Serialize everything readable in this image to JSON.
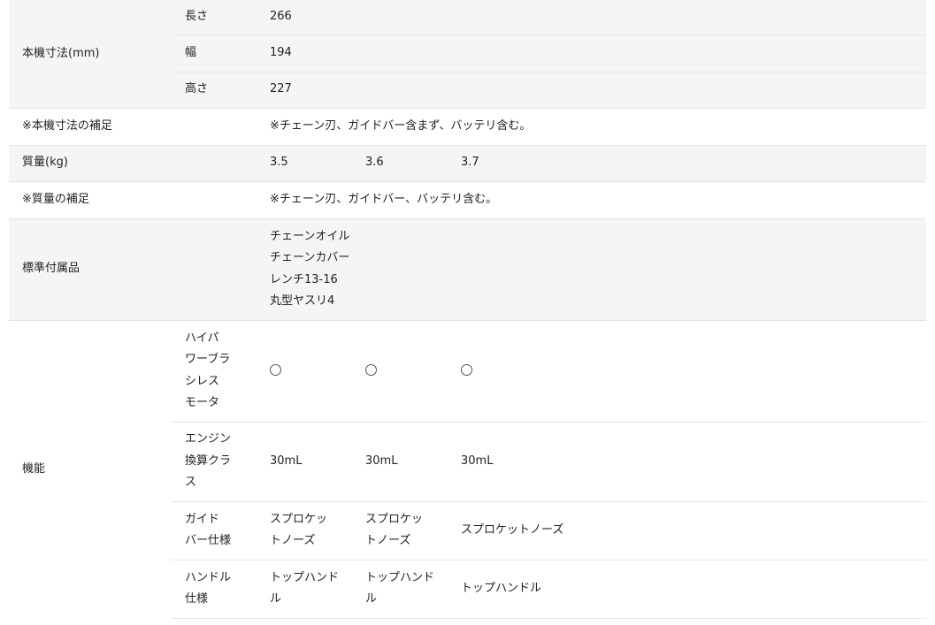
{
  "dimensions": {
    "label": "本機寸法(mm)",
    "length_label": "長さ",
    "length_value": "266",
    "width_label": "幅",
    "width_value": "194",
    "height_label": "高さ",
    "height_value": "227"
  },
  "dimensions_note": {
    "label": "※本機寸法の補足",
    "value": "※チェーン刃、ガイドバー含まず、バッテリ含む。"
  },
  "weight": {
    "label": "質量(kg)",
    "values": [
      "3.5",
      "3.6",
      "3.7"
    ]
  },
  "weight_note": {
    "label": "※質量の補足",
    "value": "※チェーン刃、ガイドバー、バッテリ含む。"
  },
  "accessories": {
    "label": "標準付属品",
    "items": [
      "チェーンオイル",
      "チェーンカバー",
      "レンチ13-16",
      "丸型ヤスリ4"
    ]
  },
  "functions": {
    "label": "機能",
    "motor": {
      "label_lines": [
        "ハイパ",
        "ワーブラ",
        "シレス",
        "モータ"
      ],
      "values": [
        "○",
        "○",
        "○"
      ]
    },
    "engine_equiv": {
      "label_lines": [
        "エンジン",
        "換算クラ",
        "ス"
      ],
      "values": [
        "30mL",
        "30mL",
        "30mL"
      ]
    },
    "guide_bar": {
      "label_lines": [
        "ガイド",
        "バー仕様"
      ],
      "col1_lines": [
        "スプロケッ",
        "トノーズ"
      ],
      "col2_lines": [
        "スプロケッ",
        "トノーズ"
      ],
      "col3": "スプロケットノーズ"
    },
    "handle": {
      "label_lines": [
        "ハンドル",
        "仕様"
      ],
      "col1_lines": [
        "トップハンド",
        "ル"
      ],
      "col2_lines": [
        "トップハンド",
        "ル"
      ],
      "col3": "トップハンドル"
    }
  }
}
